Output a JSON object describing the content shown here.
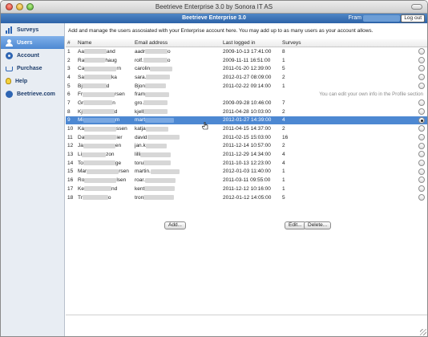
{
  "window": {
    "title": "Beetrieve Enterprise 3.0 by Sonora IT AS"
  },
  "header": {
    "title": "Beetrieve Enterprise 3.0",
    "user_prefix": "Fram",
    "logout_label": "Log out"
  },
  "sidebar": {
    "items": [
      {
        "label": "Surveys",
        "icon": "bar-chart-icon",
        "active": false
      },
      {
        "label": "Users",
        "icon": "user-icon",
        "active": true
      },
      {
        "label": "Account",
        "icon": "account-icon",
        "active": false
      },
      {
        "label": "Purchase",
        "icon": "cart-icon",
        "active": false
      },
      {
        "label": "Help",
        "icon": "lightbulb-icon",
        "active": false
      },
      {
        "label": "Beetrieve.com",
        "icon": "bee-icon",
        "active": false
      }
    ]
  },
  "main": {
    "intro": "Add and manage the users assosiated with your Enterprise account here. You may add up to as many users as your account allows.",
    "profile_hint": "You can edit your own info in the Profile section",
    "columns": [
      "#",
      "Name",
      "Email address",
      "Last logged in",
      "Surveys"
    ],
    "rows": [
      {
        "num": "1",
        "name_a": "Aa",
        "name_b": "and",
        "email": "aadr",
        "email_end": "o",
        "last": "2009-10-13 17:41:00",
        "surveys": "8"
      },
      {
        "num": "2",
        "name_a": "Ra",
        "name_b": "haug",
        "email": "rolf.",
        "email_end": "o",
        "last": "2009-11-11 16:51:00",
        "surveys": "1"
      },
      {
        "num": "3",
        "name_a": "Ca",
        "name_b": "rn",
        "email": "carolin",
        "email_end": "",
        "last": "2011-01-20 12:39:00",
        "surveys": "5"
      },
      {
        "num": "4",
        "name_a": "Sa",
        "name_b": "ka",
        "email": "sara.",
        "email_end": "",
        "last": "2012-01-27 08:09:00",
        "surveys": "2"
      },
      {
        "num": "5",
        "name_a": "Bj",
        "name_b": "d",
        "email": "Bjon",
        "email_end": "",
        "last": "2011-02-22 09:14:00",
        "surveys": "1"
      },
      {
        "num": "6",
        "name_a": "Fr",
        "name_b": "rsen",
        "email": "fram",
        "email_end": "",
        "last": "",
        "surveys": "",
        "hint": true
      },
      {
        "num": "7",
        "name_a": "Gr",
        "name_b": "n",
        "email": "gro.",
        "email_end": "",
        "last": "2009-09-28 10:46:00",
        "surveys": "7"
      },
      {
        "num": "8",
        "name_a": "Kj",
        "name_b": "d",
        "email": "kjell",
        "email_end": "",
        "last": "2011-04-28 10:03:00",
        "surveys": "2"
      },
      {
        "num": "9",
        "name_a": "Mi",
        "name_b": "m",
        "email": "mart",
        "email_end": "",
        "last": "2012-01-27 14:39:00",
        "surveys": "4",
        "selected": true
      },
      {
        "num": "10",
        "name_a": "Ka",
        "name_b": "ssen",
        "email": "katja",
        "email_end": "",
        "last": "2011-04-15 14:37:00",
        "surveys": "2"
      },
      {
        "num": "11",
        "name_a": "Da",
        "name_b": "ier",
        "email": "david",
        "email_end": "",
        "last": "2011-02-15 15:03:00",
        "surveys": "16"
      },
      {
        "num": "12",
        "name_a": "Ja",
        "name_b": "en",
        "email": "jan.k",
        "email_end": "",
        "last": "2011-12-14 10:57:00",
        "surveys": "2"
      },
      {
        "num": "13",
        "name_a": "Li",
        "name_b": "zon",
        "email": "lilli",
        "email_end": "",
        "last": "2011-12-29 14:34:00",
        "surveys": "4"
      },
      {
        "num": "14",
        "name_a": "To",
        "name_b": "ge",
        "email": "toru",
        "email_end": "",
        "last": "2011-10-13 12:23:00",
        "surveys": "4"
      },
      {
        "num": "15",
        "name_a": "Mar",
        "name_b": "rsen",
        "email": "martin.",
        "email_end": "",
        "last": "2012-01-03 11:40:00",
        "surveys": "1"
      },
      {
        "num": "16",
        "name_a": "Ro",
        "name_b": "lsen",
        "email": "roar.",
        "email_end": "",
        "last": "2011-03-11 09:55:00",
        "surveys": "1"
      },
      {
        "num": "17",
        "name_a": "Ke",
        "name_b": "nd",
        "email": "kent",
        "email_end": "",
        "last": "2011-12-12 10:16:00",
        "surveys": "1"
      },
      {
        "num": "18",
        "name_a": "Tr",
        "name_b": "o",
        "email": "tron",
        "email_end": "",
        "last": "2012-01-12 14:05:00",
        "surveys": "5"
      }
    ],
    "buttons": {
      "add": "Add...",
      "edit": "Edit...",
      "delete": "Delete..."
    }
  }
}
